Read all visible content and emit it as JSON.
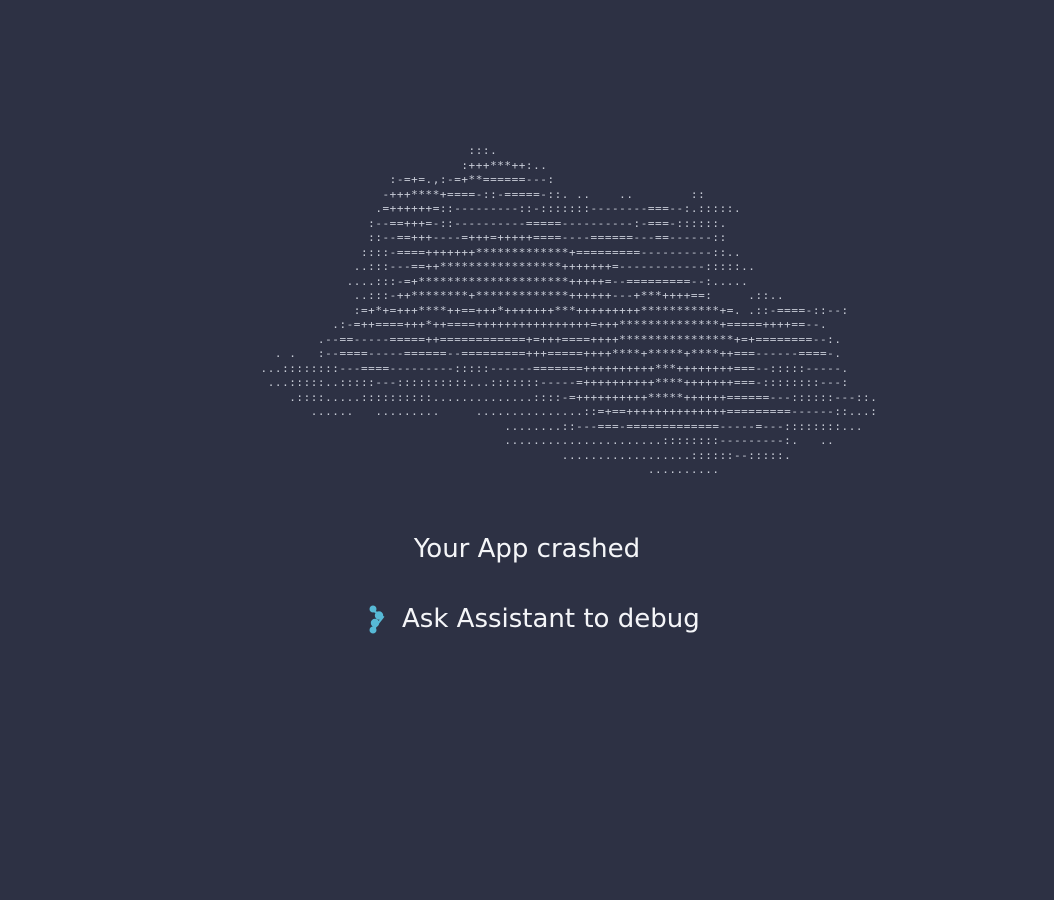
{
  "crash": {
    "ascii_art": "                                      :::.\n                                     :+++***++:..\n                           :-=+=.,:-=+**======---:\n                          -+++****+====-::-=====-::. ..    ..        ::\n                         .=++++++=::---------::-:::::::--------===--:.:::::.\n                        :--==+++=-::----------=====----------:-===-::::::.\n                        ::--==+++----=+++=+++++====----======---==------::\n                       ::::-====+++++++*************+=========----------::..\n                      ..:::---==++*****************+++++++=------------:::::..\n                     ....:::-=+*********************+++++=--=========--:.....\n                      ..:::-++********+*************++++++---+***++++==:     .::..\n                      :=+*+=+++****++==+++*+++++++***+++++++++***********+=. .::-====-::--:\n                   .:-=++====+++*++====++++++++++++++++=+++**************+=====++++==--.\n                 .--==-----=====++============+=+++====++++****************+=+========--:.\n           . .   :--====-----======--=========+++=====++++****+*****+****++===------====-.\n         ...::::::::---====---------:::::------=======++++++++++***++++++++===--:::::-----.\n          ...:::::..:::::---::::::::::...:::::::-----=++++++++++****+++++++===-::::::::---:\n             .::::.....::::::::::..............::::-=++++++++++*****++++++======---::::::---::.\n                ......   .........     ...............::=+==++++++++++++++=========------::...:\n                                           ........::---===-=============-----=---::::::::...\n                                           ......................::::::::---------:.   ..\n                                                   ..................::::::--:::::.\n                                                               ..........",
    "title": "Your App crashed",
    "debug_label": "Ask Assistant to debug"
  },
  "colors": {
    "background": "#2d3144",
    "art": "#c9cdd8",
    "text": "#f4f5f8",
    "assistant_icon": "#57b9d6"
  },
  "icons": {
    "assistant": "assistant-icon"
  }
}
